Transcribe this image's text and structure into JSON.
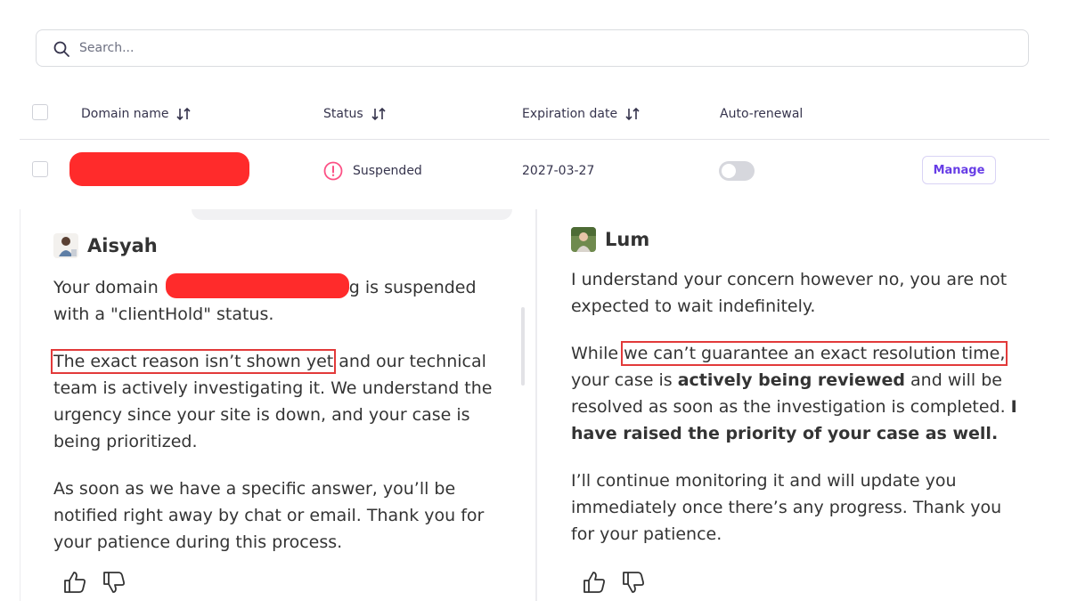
{
  "search": {
    "placeholder": "Search..."
  },
  "table": {
    "columns": [
      "Domain name",
      "Status",
      "Expiration date",
      "Auto-renewal"
    ],
    "rows": [
      {
        "domain": "",
        "status": "Suspended",
        "expiration": "2027-03-27",
        "auto_renewal": false,
        "action": "Manage"
      }
    ]
  },
  "chat_left": {
    "author": "Aisyah",
    "p1_before": "Your domain ",
    "p1_after": "g is suspended with a \"clientHold\" status.",
    "p2_highlight": "The exact reason isn’t shown yet",
    "p2_rest": " and our technical team is actively investigating it. We understand the urgency since your site is down, and your case is being prioritized.",
    "p3": "As soon as we have a specific answer, you’ll be notified right away by chat or email. Thank you for your patience during this process."
  },
  "chat_right": {
    "author": "Lum",
    "p1": "I understand your concern however no, you are not expected to wait indefinitely.",
    "p2_start": "While ",
    "p2_highlight": "we can’t guarantee an exact resolution time,",
    "p2_mid": " your case is ",
    "p2_bold1": "actively being reviewed",
    "p2_mid2": " and will be resolved as soon as the investigation is completed. ",
    "p2_bold2": "I have raised the priority of your case as well.",
    "p3": "I’ll continue monitoring it and will update you immediately once there’s any progress. Thank you for your patience."
  },
  "icons": {
    "search": "search-icon",
    "sort": "sort-arrows-icon",
    "status": "alert-circle-icon",
    "thumbs_up": "thumbs-up-icon",
    "thumbs_down": "thumbs-down-icon"
  },
  "colors": {
    "accent": "#673de6",
    "danger": "#fc5185",
    "redaction": "#ff2b2b",
    "highlight_box": "#e23a3a"
  }
}
